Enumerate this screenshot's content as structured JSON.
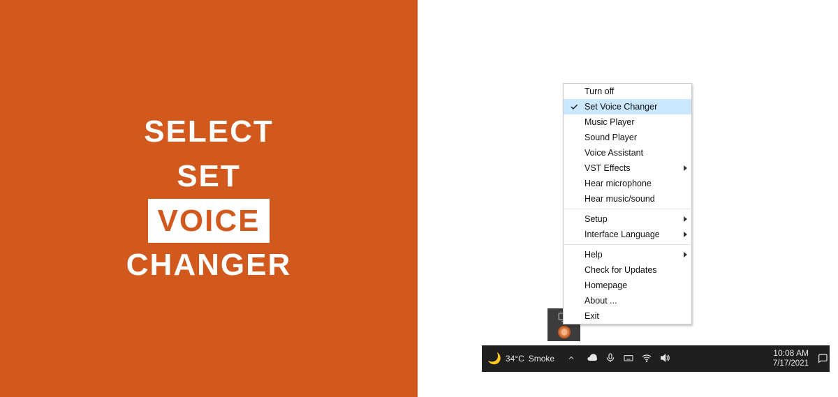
{
  "hero": {
    "line1": "SELECT",
    "line2": "SET",
    "line3": "VOICE",
    "line4": "CHANGER"
  },
  "context_menu": {
    "items": [
      {
        "label": "Turn off",
        "checked": false,
        "submenu": false,
        "highlight": false
      },
      {
        "label": "Set Voice Changer",
        "checked": true,
        "submenu": false,
        "highlight": true
      },
      {
        "label": "Music Player",
        "checked": false,
        "submenu": false,
        "highlight": false
      },
      {
        "label": "Sound Player",
        "checked": false,
        "submenu": false,
        "highlight": false
      },
      {
        "label": "Voice Assistant",
        "checked": false,
        "submenu": false,
        "highlight": false
      },
      {
        "label": "VST Effects",
        "checked": false,
        "submenu": true,
        "highlight": false
      },
      {
        "label": "Hear microphone",
        "checked": false,
        "submenu": false,
        "highlight": false
      },
      {
        "label": "Hear music/sound",
        "checked": false,
        "submenu": false,
        "highlight": false
      },
      {
        "sep": true
      },
      {
        "label": "Setup",
        "checked": false,
        "submenu": true,
        "highlight": false
      },
      {
        "label": "Interface Language",
        "checked": false,
        "submenu": true,
        "highlight": false
      },
      {
        "sep": true
      },
      {
        "label": "Help",
        "checked": false,
        "submenu": true,
        "highlight": false
      },
      {
        "label": "Check for Updates",
        "checked": false,
        "submenu": false,
        "highlight": false
      },
      {
        "label": "Homepage",
        "checked": false,
        "submenu": false,
        "highlight": false
      },
      {
        "label": "About ...",
        "checked": false,
        "submenu": false,
        "highlight": false
      },
      {
        "label": "Exit",
        "checked": false,
        "submenu": false,
        "highlight": false
      }
    ]
  },
  "taskbar": {
    "weather_temp": "34°C",
    "weather_cond": "Smoke",
    "time": "10:08 AM",
    "date": "7/17/2021"
  }
}
